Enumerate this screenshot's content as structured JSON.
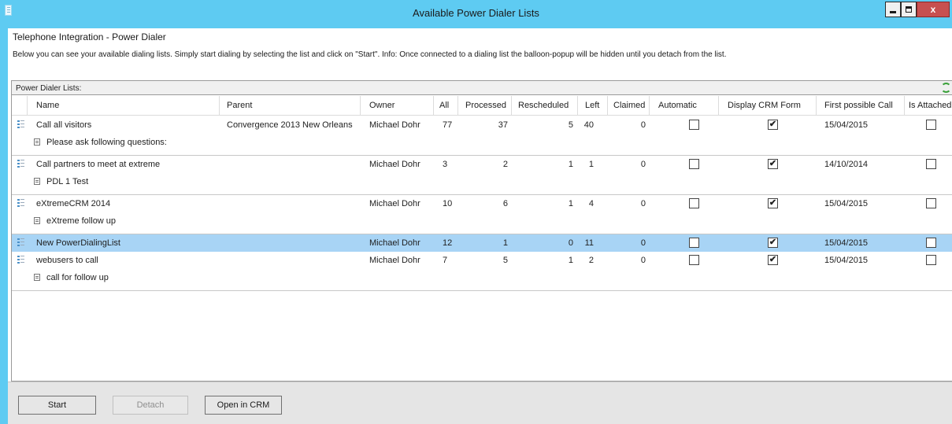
{
  "window": {
    "title": "Available Power Dialer Lists",
    "close_label": "x"
  },
  "heading": "Telephone Integration - Power Dialer",
  "info_text": "Below you can see your available dialing lists. Simply start dialing by selecting the list and click on \"Start\". Info: Once connected to a dialing list the balloon-popup will be hidden until you detach from the list.",
  "panel": {
    "caption": "Power Dialer Lists:",
    "refresh_icon": "refresh-icon"
  },
  "columns": {
    "name": "Name",
    "parent": "Parent",
    "owner": "Owner",
    "all": "All",
    "processed": "Processed",
    "rescheduled": "Rescheduled",
    "left": "Left",
    "claimed": "Claimed",
    "automatic": "Automatic",
    "display_crm_form": "Display CRM Form",
    "first_possible_call": "First possible Call",
    "is_attached": "Is Attached"
  },
  "rows": [
    {
      "name": "Call all visitors",
      "parent": "Convergence 2013 New Orleans",
      "owner": "Michael Dohr",
      "all": "77",
      "processed": "37",
      "rescheduled": "5",
      "left": "40",
      "claimed": "0",
      "automatic": false,
      "display_crm_form": true,
      "first_possible_call": "15/04/2015",
      "is_attached": false,
      "sub": "Please ask following questions:",
      "selected": false
    },
    {
      "name": "Call partners to meet at extreme",
      "parent": "",
      "owner": "Michael Dohr",
      "all": "3",
      "processed": "2",
      "rescheduled": "1",
      "left": "1",
      "claimed": "0",
      "automatic": false,
      "display_crm_form": true,
      "first_possible_call": "14/10/2014",
      "is_attached": false,
      "sub": "PDL 1 Test",
      "selected": false
    },
    {
      "name": "eXtremeCRM 2014",
      "parent": "",
      "owner": "Michael Dohr",
      "all": "10",
      "processed": "6",
      "rescheduled": "1",
      "left": "4",
      "claimed": "0",
      "automatic": false,
      "display_crm_form": true,
      "first_possible_call": "15/04/2015",
      "is_attached": false,
      "sub": "eXtreme follow up",
      "selected": false
    },
    {
      "name": "New PowerDialingList",
      "parent": "",
      "owner": "Michael Dohr",
      "all": "12",
      "processed": "1",
      "rescheduled": "0",
      "left": "11",
      "claimed": "0",
      "automatic": false,
      "display_crm_form": true,
      "first_possible_call": "15/04/2015",
      "is_attached": false,
      "sub": "",
      "selected": true
    },
    {
      "name": "webusers to call",
      "parent": "",
      "owner": "Michael Dohr",
      "all": "7",
      "processed": "5",
      "rescheduled": "1",
      "left": "2",
      "claimed": "0",
      "automatic": false,
      "display_crm_form": true,
      "first_possible_call": "15/04/2015",
      "is_attached": false,
      "sub": "call for follow up",
      "selected": false
    }
  ],
  "buttons": {
    "start": "Start",
    "detach": "Detach",
    "open_in_crm": "Open in CRM"
  },
  "colors": {
    "titlebar": "#5ecbf2",
    "selection": "#a8d4f5"
  }
}
